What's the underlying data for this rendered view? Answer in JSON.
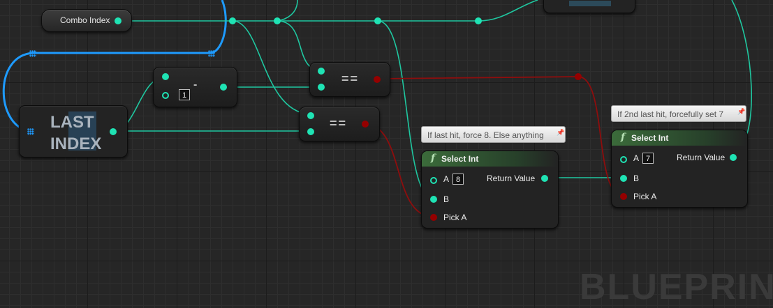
{
  "variable_node": {
    "label": "Combo Index"
  },
  "last_index_node": {
    "label_line1": "LAST",
    "label_line2": "INDEX"
  },
  "subtract_node": {
    "operator": "-",
    "b_value": "1"
  },
  "equal_node_1": {
    "operator": "=="
  },
  "equal_node_2": {
    "operator": "=="
  },
  "select_int_1": {
    "title": "Select Int",
    "icon": "function-icon",
    "comment": "If last hit, force 8. Else anything",
    "pin_a_label": "A",
    "pin_a_value": "8",
    "pin_b_label": "B",
    "pin_pick_label": "Pick A",
    "return_label": "Return Value"
  },
  "select_int_2": {
    "title": "Select Int",
    "icon": "function-icon",
    "comment": "If 2nd last hit, forcefully set 7",
    "pin_a_label": "A",
    "pin_a_value": "7",
    "pin_b_label": "B",
    "pin_pick_label": "Pick A",
    "return_label": "Return Value"
  },
  "watermark": "BLUEPRINT",
  "colors": {
    "int_pin": "#1fe3b4",
    "bool_pin": "#950000",
    "exec_wire": "#1e9bff",
    "func_header": "#3b6b3a"
  }
}
